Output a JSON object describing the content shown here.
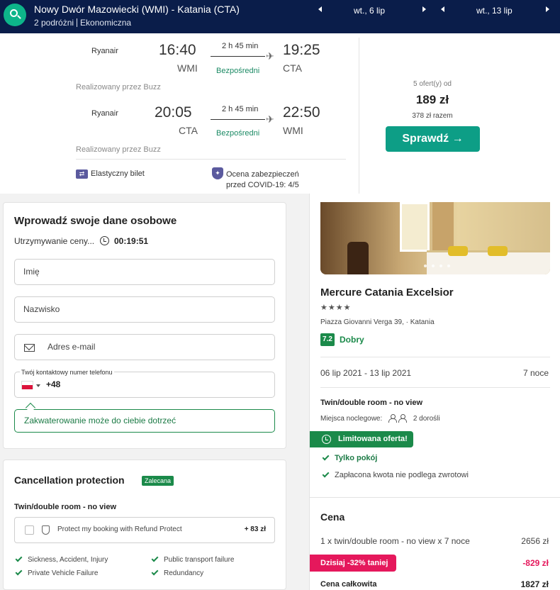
{
  "header": {
    "route": "Nowy Dwór Mazowiecki (WMI) - Katania (CTA)",
    "travellers": "2 podróżni",
    "cabin": "Ekonomiczna",
    "depart_date": "wt., 6 lip",
    "return_date": "wt., 13 lip"
  },
  "flights": [
    {
      "airline": "Ryanair",
      "dep_time": "16:40",
      "dep_code": "WMI",
      "duration": "2 h 45 min",
      "stops": "Bezpośredni",
      "arr_time": "19:25",
      "arr_code": "CTA",
      "operated_by": "Realizowany przez Buzz"
    },
    {
      "airline": "Ryanair",
      "dep_time": "20:05",
      "dep_code": "CTA",
      "duration": "2 h 45 min",
      "stops": "Bezpośredni",
      "arr_time": "22:50",
      "arr_code": "WMI",
      "operated_by": "Realizowany przez Buzz"
    }
  ],
  "flight_features": {
    "flexible": "Elastyczny bilet",
    "covid_line1": "Ocena zabezpieczeń",
    "covid_line2": "przed COVID-19: 4/5"
  },
  "offer": {
    "count": "5 ofert(y) od",
    "price": "189 zł",
    "total": "378 zł razem",
    "cta": "Sprawdź →"
  },
  "form": {
    "title": "Wprowadź swoje dane osobowe",
    "hold_label": "Utrzymywanie ceny...",
    "timer": "00:19:51",
    "first_name_placeholder": "Imię",
    "last_name_placeholder": "Nazwisko",
    "email_placeholder": "Adres e-mail",
    "phone_label": "Twój kontaktowy numer telefonu",
    "phone_prefix": "+48",
    "notice": "Zakwaterowanie może do ciebie dotrzeć"
  },
  "cancellation": {
    "title": "Cancellation protection",
    "badge": "Zalecana",
    "room": "Twin/double room - no view",
    "protect_label": "Protect my booking with Refund Protect",
    "protect_price": "+ 83 zł",
    "benefits": [
      "Sickness, Accident, Injury",
      "Public transport failure",
      "Private Vehicle Failure",
      "Redundancy"
    ]
  },
  "hotel": {
    "name": "Mercure Catania Excelsior",
    "stars": "★★★★",
    "star_rating": 4,
    "address": "Piazza Giovanni Verga 39, · Katania",
    "score": "7.2",
    "score_word": "Dobry",
    "dates": "06 lip 2021 - 13 lip 2021",
    "nights": "7 noce",
    "room": "Twin/double room - no view",
    "beds_label": "Miejsca noclegowe:",
    "guests": "2 dorośli",
    "limited": "Limitowana oferta!",
    "perks": [
      "Tylko pokój",
      "Zapłacona kwota nie podlega zwrotowi"
    ]
  },
  "price": {
    "title": "Cena",
    "line": "1 x twin/double room - no view x 7 noce",
    "line_value": "2656 zł",
    "discount": "Dzisiaj -32% taniej",
    "discount_value": "-829 zł",
    "total_label": "Cena całkowita",
    "total_value": "1827 zł"
  },
  "colors": {
    "header_bg": "#0a1d4a",
    "accent_green": "#1b8a4a",
    "cta_teal": "#0d9e86",
    "discount_pink": "#e5185c",
    "brand_purple": "#5b5a9e"
  }
}
